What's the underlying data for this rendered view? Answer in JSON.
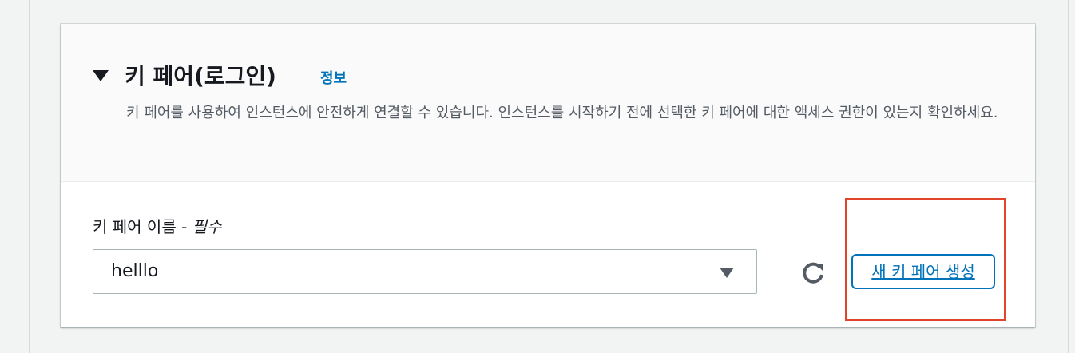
{
  "section": {
    "title": "키 페어(로그인)",
    "info_link": "정보",
    "description": "키 페어를 사용하여 인스턴스에 안전하게 연결할 수 있습니다. 인스턴스를 시작하기 전에 선택한 키 페어에 대한 액세스 권한이 있는지 확인하세요."
  },
  "key_pair_field": {
    "label": "키 페어 이름 -",
    "required_label": "필수",
    "selected_value": "helllo"
  },
  "actions": {
    "create_key_pair_label": "새 키 페어 생성",
    "refresh_icon": "refresh-icon"
  },
  "colors": {
    "link": "#0073bb",
    "highlight_border": "#e0442b",
    "text_primary": "#16191f",
    "text_secondary": "#545b64"
  }
}
